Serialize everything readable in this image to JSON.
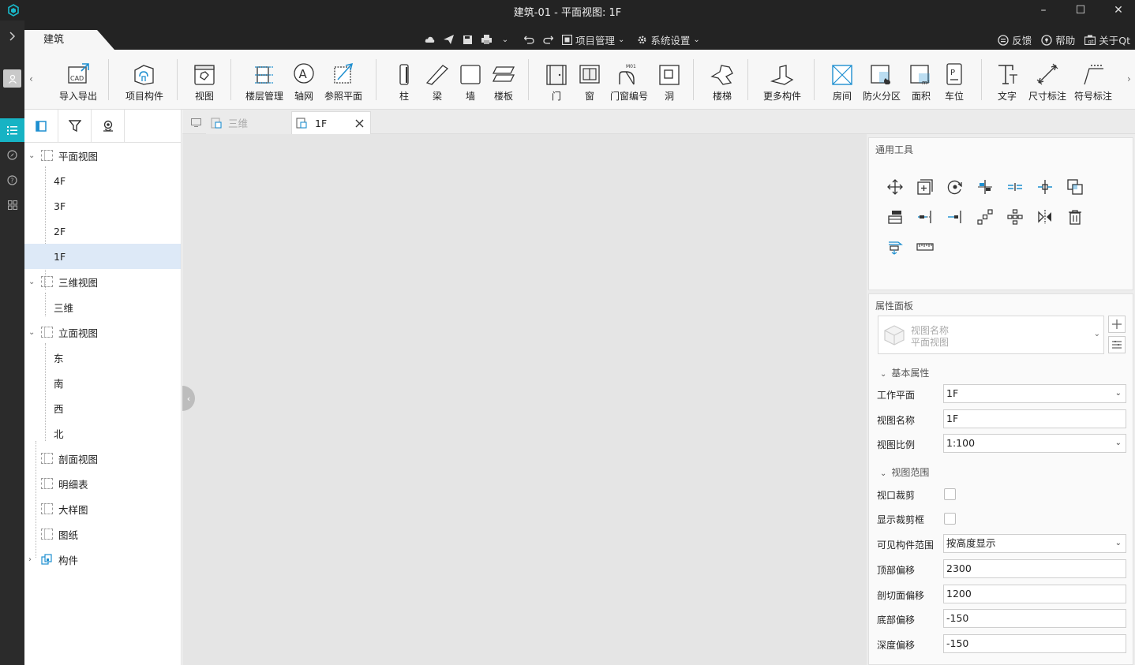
{
  "window": {
    "title": "建筑-01 - 平面视图: 1F"
  },
  "menubar": {
    "active_tab": "建筑",
    "project_mgmt": "项目管理",
    "system_settings": "系统设置",
    "feedback": "反馈",
    "help": "帮助",
    "about": "关于Qt"
  },
  "ribbon": {
    "import_export": "导入导出",
    "project_components": "项目构件",
    "view": "视图",
    "floor_mgmt": "楼层管理",
    "axis_grid": "轴网",
    "ref_plane": "参照平面",
    "column": "柱",
    "beam": "梁",
    "wall": "墙",
    "slab": "楼板",
    "door": "门",
    "window": "窗",
    "door_window_number": "门窗编号",
    "door_window_tag": "M01",
    "opening": "洞",
    "stair": "楼梯",
    "more_components": "更多构件",
    "room": "房间",
    "fire_zone": "防火分区",
    "area": "面积",
    "parking": "车位",
    "text": "文字",
    "dimension": "尺寸标注",
    "symbol": "符号标注"
  },
  "tree": {
    "plan_views": "平面视图",
    "f4": "4F",
    "f3": "3F",
    "f2": "2F",
    "f1": "1F",
    "views_3d": "三维视图",
    "v3d": "三维",
    "elev_views": "立面视图",
    "east": "东",
    "south": "南",
    "west": "西",
    "north": "北",
    "section_views": "剖面视图",
    "schedules": "明细表",
    "detail_views": "大样图",
    "sheets": "图纸",
    "components": "构件"
  },
  "doc_tabs": {
    "tab_3d": "三维",
    "tab_1f": "1F"
  },
  "tools_panel": {
    "title": "通用工具"
  },
  "properties": {
    "title": "属性面板",
    "view_name_hint": "视图名称",
    "view_type_hint": "平面视图",
    "basic_section": "基本属性",
    "work_plane_label": "工作平面",
    "work_plane_value": "1F",
    "view_name_label": "视图名称",
    "view_name_value": "1F",
    "scale_label": "视图比例",
    "scale_value": "1:100",
    "range_section": "视图范围",
    "crop_label": "视口裁剪",
    "crop_box_label": "显示裁剪框",
    "visible_range_label": "可见构件范围",
    "visible_range_value": "按高度显示",
    "top_offset_label": "顶部偏移",
    "top_offset_value": "2300",
    "cut_offset_label": "剖切面偏移",
    "cut_offset_value": "1200",
    "bottom_offset_label": "底部偏移",
    "bottom_offset_value": "-150",
    "depth_offset_label": "深度偏移",
    "depth_offset_value": "-150"
  }
}
